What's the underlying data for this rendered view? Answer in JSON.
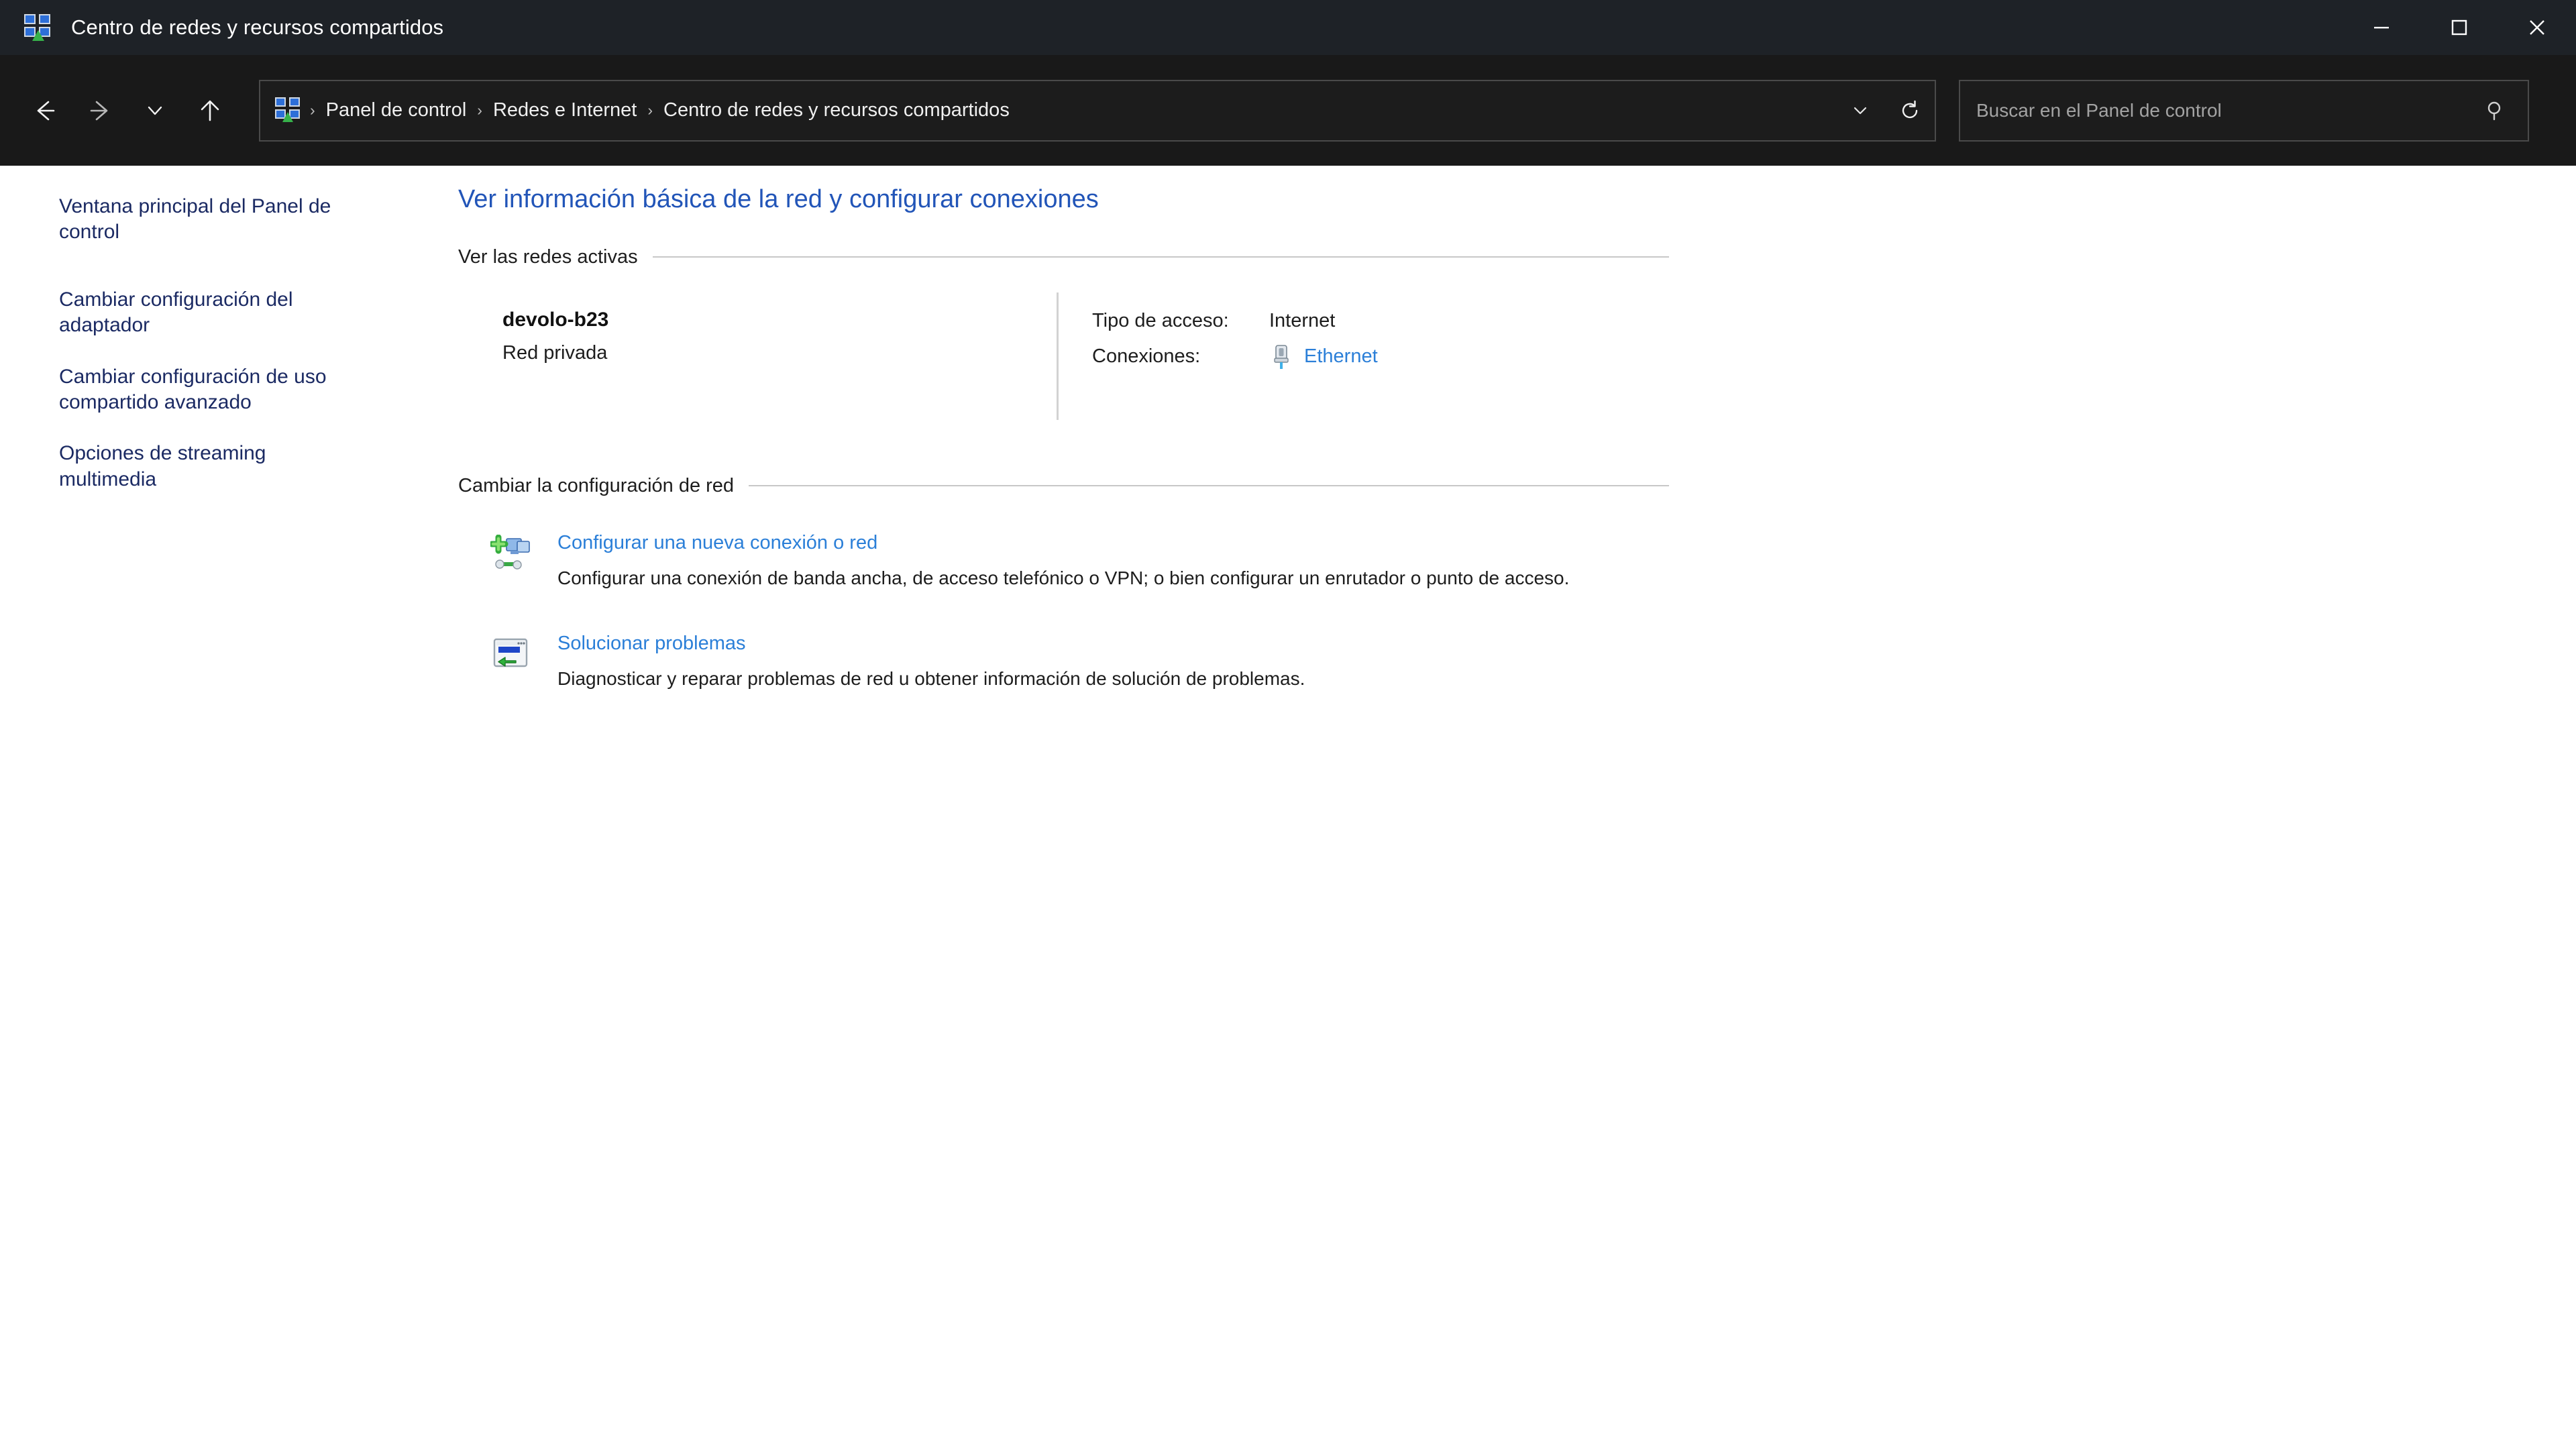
{
  "window": {
    "title": "Centro de redes y recursos compartidos",
    "app_icon": "network-sharing-icon",
    "controls": {
      "minimize": "minimize-icon",
      "maximize": "maximize-icon",
      "close": "close-icon"
    }
  },
  "nav": {
    "back": "back-arrow-icon",
    "forward": "forward-arrow-icon",
    "recent": "chevron-down-icon",
    "up": "up-arrow-icon",
    "refresh": "refresh-icon",
    "history_dropdown": "chevron-down-icon",
    "breadcrumb": [
      "Panel de control",
      "Redes e Internet",
      "Centro de redes y recursos compartidos"
    ],
    "separator": "›"
  },
  "search": {
    "placeholder": "Buscar en el Panel de control",
    "value": "",
    "icon": "search-icon"
  },
  "sidebar": {
    "items": [
      {
        "label": "Ventana principal del Panel de control"
      },
      {
        "label": "Cambiar configuración del adaptador"
      },
      {
        "label": "Cambiar configuración de uso compartido avanzado"
      },
      {
        "label": "Opciones de streaming multimedia"
      }
    ]
  },
  "main": {
    "heading": "Ver información básica de la red y configurar conexiones",
    "sections": {
      "active_networks": {
        "title": "Ver las redes activas",
        "network": {
          "name": "devolo-b23",
          "type": "Red privada",
          "fields": [
            {
              "label": "Tipo de acceso:",
              "value": "Internet",
              "is_link": false
            },
            {
              "label": "Conexiones:",
              "value": "Ethernet",
              "is_link": true,
              "icon": "ethernet-connector-icon"
            }
          ]
        }
      },
      "change_settings": {
        "title": "Cambiar la configuración de red",
        "tasks": [
          {
            "icon": "new-connection-icon",
            "link": "Configurar una nueva conexión o red",
            "description": "Configurar una conexión de banda ancha, de acceso telefónico o VPN; o bien configurar un enrutador o punto de acceso."
          },
          {
            "icon": "troubleshoot-icon",
            "link": "Solucionar problemas",
            "description": "Diagnosticar y reparar problemas de red u obtener información de solución de problemas."
          }
        ]
      }
    }
  },
  "colors": {
    "titlebar_bg": "#1e2227",
    "navbar_bg": "#191919",
    "content_bg": "#ffffff",
    "heading_blue": "#2255b8",
    "link_blue": "#2b7fd8",
    "sidebar_link": "#1b2a63",
    "rule_gray": "#c8c8c8"
  }
}
